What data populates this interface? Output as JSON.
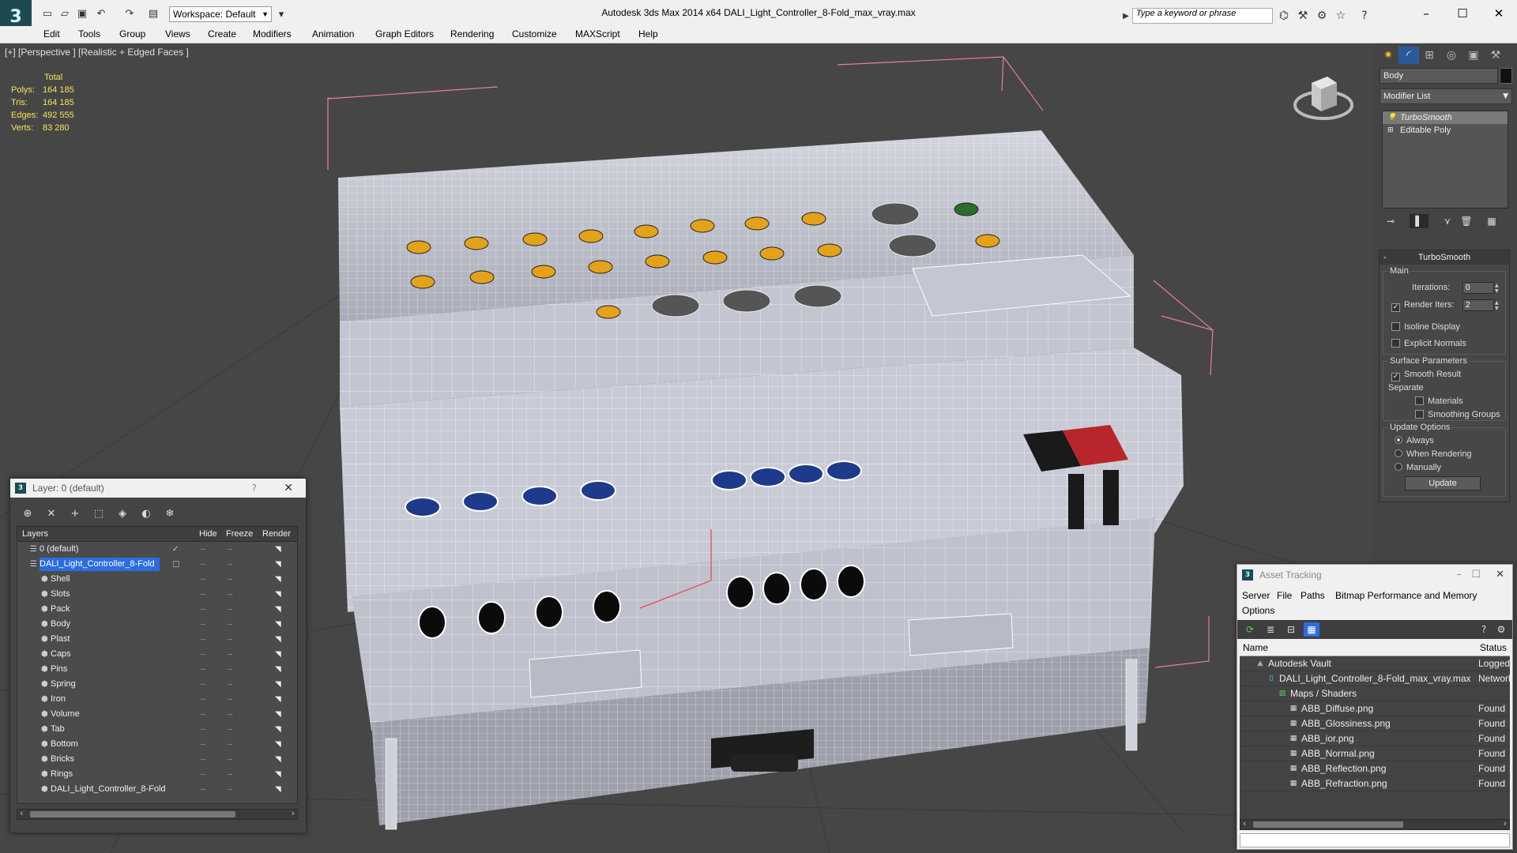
{
  "app": {
    "title": "Autodesk 3ds Max  2014 x64      DALI_Light_Controller_8-Fold_max_vray.max",
    "logo": "3",
    "workspace": "Workspace: Default",
    "search_placeholder": "Type a keyword or phrase"
  },
  "menu": [
    "Edit",
    "Tools",
    "Group",
    "Views",
    "Create",
    "Modifiers",
    "Animation",
    "Graph Editors",
    "Rendering",
    "Customize",
    "MAXScript",
    "Help"
  ],
  "viewport": {
    "label": "[+] [Perspective ] [Realistic + Edged Faces ]",
    "stats": {
      "header": "Total",
      "rows": [
        {
          "label": "Polys:",
          "value": "164 185"
        },
        {
          "label": "Tris:",
          "value": "164 185"
        },
        {
          "label": "Edges:",
          "value": "492 555"
        },
        {
          "label": "Verts:",
          "value": "83 280"
        }
      ]
    }
  },
  "command_panel": {
    "object_name": "Body",
    "modifier_list": "Modifier List",
    "stack": [
      "TurboSmooth",
      "Editable Poly"
    ],
    "rollout_title": "TurboSmooth",
    "main_group": "Main",
    "iterations_label": "Iterations:",
    "iterations_value": "0",
    "render_iters_label": "Render Iters:",
    "render_iters_value": "2",
    "isoline": "Isoline Display",
    "explicit_normals": "Explicit Normals",
    "surface_group": "Surface Parameters",
    "smooth_result": "Smooth Result",
    "separate": "Separate",
    "materials": "Materials",
    "smoothing_groups": "Smoothing Groups",
    "update_group": "Update Options",
    "always": "Always",
    "when_rendering": "When Rendering",
    "manually": "Manually",
    "update_button": "Update"
  },
  "layer_dialog": {
    "title": "Layer: 0 (default)",
    "help": "?",
    "columns": {
      "layers": "Layers",
      "hide": "Hide",
      "freeze": "Freeze",
      "render": "Render"
    },
    "rows": [
      {
        "name": "0 (default)",
        "level": 0
      },
      {
        "name": "DALI_Light_Controller_8-Fold",
        "level": 0
      },
      {
        "name": "Shell",
        "level": 1
      },
      {
        "name": "Slots",
        "level": 1
      },
      {
        "name": "Pack",
        "level": 1
      },
      {
        "name": "Body",
        "level": 1
      },
      {
        "name": "Plast",
        "level": 1
      },
      {
        "name": "Caps",
        "level": 1
      },
      {
        "name": "Pins",
        "level": 1
      },
      {
        "name": "Spring",
        "level": 1
      },
      {
        "name": "Iron",
        "level": 1
      },
      {
        "name": "Volume",
        "level": 1
      },
      {
        "name": "Tab",
        "level": 1
      },
      {
        "name": "Bottom",
        "level": 1
      },
      {
        "name": "Bricks",
        "level": 1
      },
      {
        "name": "Rings",
        "level": 1
      },
      {
        "name": "DALI_Light_Controller_8-Fold",
        "level": 1
      }
    ]
  },
  "asset_dialog": {
    "title": "Asset Tracking",
    "menu": [
      "Server",
      "File",
      "Paths",
      "Bitmap Performance and Memory",
      "Options"
    ],
    "columns": {
      "name": "Name",
      "status": "Status"
    },
    "rows": [
      {
        "name": "Autodesk Vault",
        "status": "Logged",
        "level": 0
      },
      {
        "name": "DALI_Light_Controller_8-Fold_max_vray.max",
        "status": "Network",
        "level": 1
      },
      {
        "name": "Maps / Shaders",
        "status": "",
        "level": 2
      },
      {
        "name": "ABB_Diffuse.png",
        "status": "Found",
        "level": 3
      },
      {
        "name": "ABB_Glossiness.png",
        "status": "Found",
        "level": 3
      },
      {
        "name": "ABB_ior.png",
        "status": "Found",
        "level": 3
      },
      {
        "name": "ABB_Normal.png",
        "status": "Found",
        "level": 3
      },
      {
        "name": "ABB_Reflection.png",
        "status": "Found",
        "level": 3
      },
      {
        "name": "ABB_Refraction.png",
        "status": "Found",
        "level": 3
      }
    ]
  },
  "colors": {
    "selection": "#2b6de0",
    "stats_text": "#f5e35a",
    "viewport_bg": "#464646",
    "model_body": "#c9ccd6",
    "orange_led": "#e3a21a",
    "blue_port": "#1e3a8a"
  }
}
